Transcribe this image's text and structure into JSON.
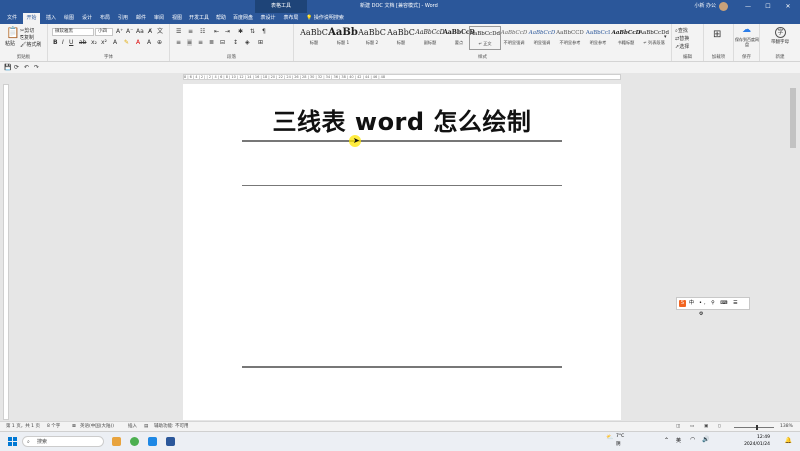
{
  "window": {
    "context_group": "表格工具",
    "title": "新建 DOC 文档 [兼容模式] - Word",
    "user": "小新 办公",
    "min": "—",
    "max": "☐",
    "close": "✕"
  },
  "tabs": [
    {
      "label": "文件",
      "active": false
    },
    {
      "label": "开始",
      "active": true
    },
    {
      "label": "插入",
      "active": false
    },
    {
      "label": "绘图",
      "active": false
    },
    {
      "label": "设计",
      "active": false
    },
    {
      "label": "布局",
      "active": false
    },
    {
      "label": "引用",
      "active": false
    },
    {
      "label": "邮件",
      "active": false
    },
    {
      "label": "审阅",
      "active": false
    },
    {
      "label": "视图",
      "active": false
    },
    {
      "label": "开发工具",
      "active": false
    },
    {
      "label": "帮助",
      "active": false
    },
    {
      "label": "百度网盘",
      "active": false
    },
    {
      "label": "表设计",
      "active": false
    },
    {
      "label": "表布局",
      "active": false
    }
  ],
  "tell_me": "操作说明搜索",
  "ribbon": {
    "clipboard": {
      "label": "剪贴板",
      "paste": "粘贴",
      "cut": "剪切",
      "copy": "复制",
      "format_painter": "格式刷"
    },
    "font": {
      "label": "字体",
      "font_name": "微软雅黑",
      "font_size": "小四"
    },
    "paragraph": {
      "label": "段落"
    },
    "styles": {
      "label": "样式",
      "items": [
        {
          "preview": "AaBbC",
          "name": "标题"
        },
        {
          "preview": "AaBb",
          "name": "标题 1"
        },
        {
          "preview": "AaBbC",
          "name": "标题 2"
        },
        {
          "preview": "AaBbC",
          "name": "标题"
        },
        {
          "preview": "AaBbCcD",
          "name": "副标题"
        },
        {
          "preview": "AaBbCcD",
          "name": "要点"
        },
        {
          "preview": "AaBbCcDd",
          "name": "↵ 正文"
        },
        {
          "preview": "AaBbCcD",
          "name": "不明显强调"
        },
        {
          "preview": "AaBbCcD",
          "name": "明显强调"
        },
        {
          "preview": "AaBbCCD",
          "name": "不明显参考"
        },
        {
          "preview": "AaBbCcI",
          "name": "明显参考"
        },
        {
          "preview": "AaBbCcD",
          "name": "书籍标题"
        },
        {
          "preview": "AaBbCcDd",
          "name": "↵ 列表段落"
        }
      ]
    },
    "editing": {
      "label": "编辑",
      "find": "查找",
      "replace": "替换",
      "select": "选择"
    },
    "addins": {
      "label": "加载项"
    },
    "save": {
      "label": "保存",
      "button": "保存到百度网盘"
    },
    "new": {
      "label": "新建",
      "button": "带翻字母"
    }
  },
  "ruler_ticks": "8 | 6 | 4 | 2 | | 2 | 4 | 6 | 8 | 10 | 12 | 14 | 16 | 18 | 20 | 22 | 24 | 26 | 28 | 30 | 32 | 34 | 36 | 38 | 40 | 42 | 44 | 46 | 48",
  "document": {
    "title": "三线表 word 怎么绘制"
  },
  "ime": {
    "logo": "S",
    "mode": "中",
    "icons": "•, ⚲ ⌨ ☰ ⚙"
  },
  "status": {
    "page": "第 1 页，共 1 页",
    "words": "8 个字",
    "language": "英语(中国(大陆))",
    "insert": "插入",
    "accessibility": "辅助功能: 不可用",
    "zoom": "138%"
  },
  "taskbar": {
    "search_placeholder": "搜索",
    "weather_temp": "7°C",
    "weather_desc": "阴",
    "time": "12:49",
    "date": "2024/01/24",
    "lang": "英"
  }
}
